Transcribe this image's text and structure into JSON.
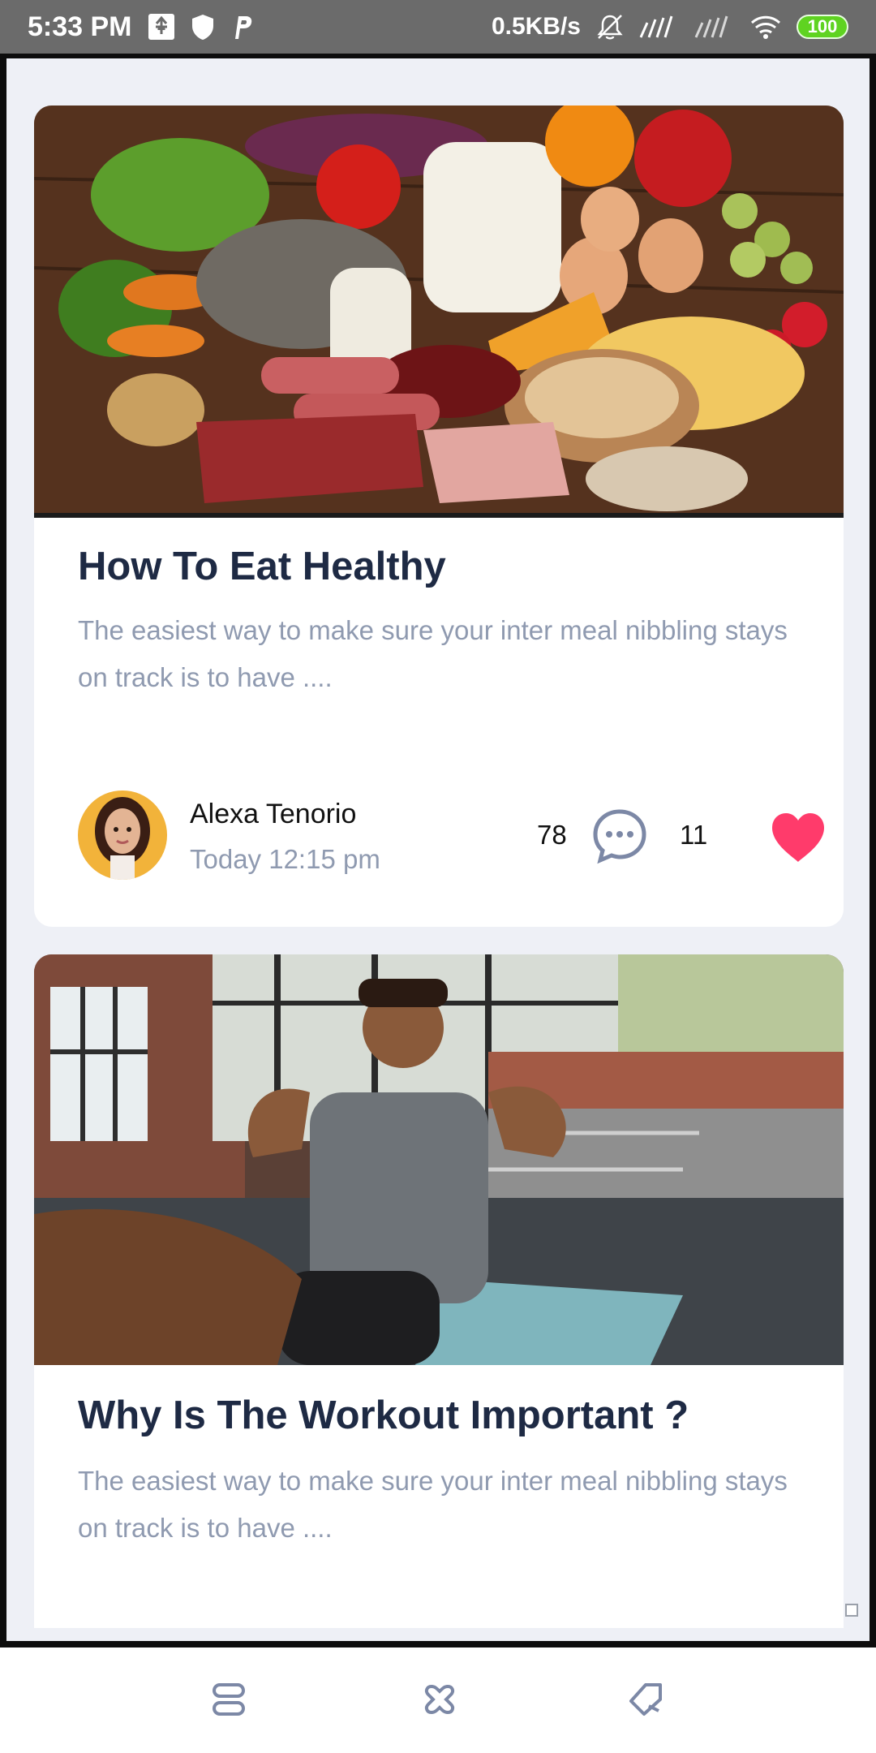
{
  "status_bar": {
    "time": "5:33 PM",
    "network_speed": "0.5KB/s",
    "battery": "100",
    "icons": [
      "usb-icon",
      "shield-icon",
      "p-icon",
      "mute-icon",
      "signal-icon",
      "signal-icon",
      "wifi-icon",
      "battery-icon"
    ]
  },
  "posts": [
    {
      "title": "How To Eat Healthy",
      "excerpt": "The easiest way to make sure your inter meal nibbling stays on track is to have ....",
      "author": "Alexa Tenorio",
      "time": "Today 12:15 pm",
      "comments": "78",
      "likes": "11",
      "image": "healthy-food-photo"
    },
    {
      "title": "Why Is The Workout Important ?",
      "excerpt": "The easiest way to make sure your inter meal nibbling stays on track is to have ....",
      "image": "workout-photo"
    }
  ],
  "bottom_nav": {
    "items": [
      "home-icon",
      "apps-icon",
      "tag-icon"
    ]
  },
  "colors": {
    "title": "#1e2a44",
    "muted": "#8f9ab0",
    "heart": "#ff3b6b",
    "comment_icon": "#7c88a6",
    "background": "#eef0f6"
  }
}
